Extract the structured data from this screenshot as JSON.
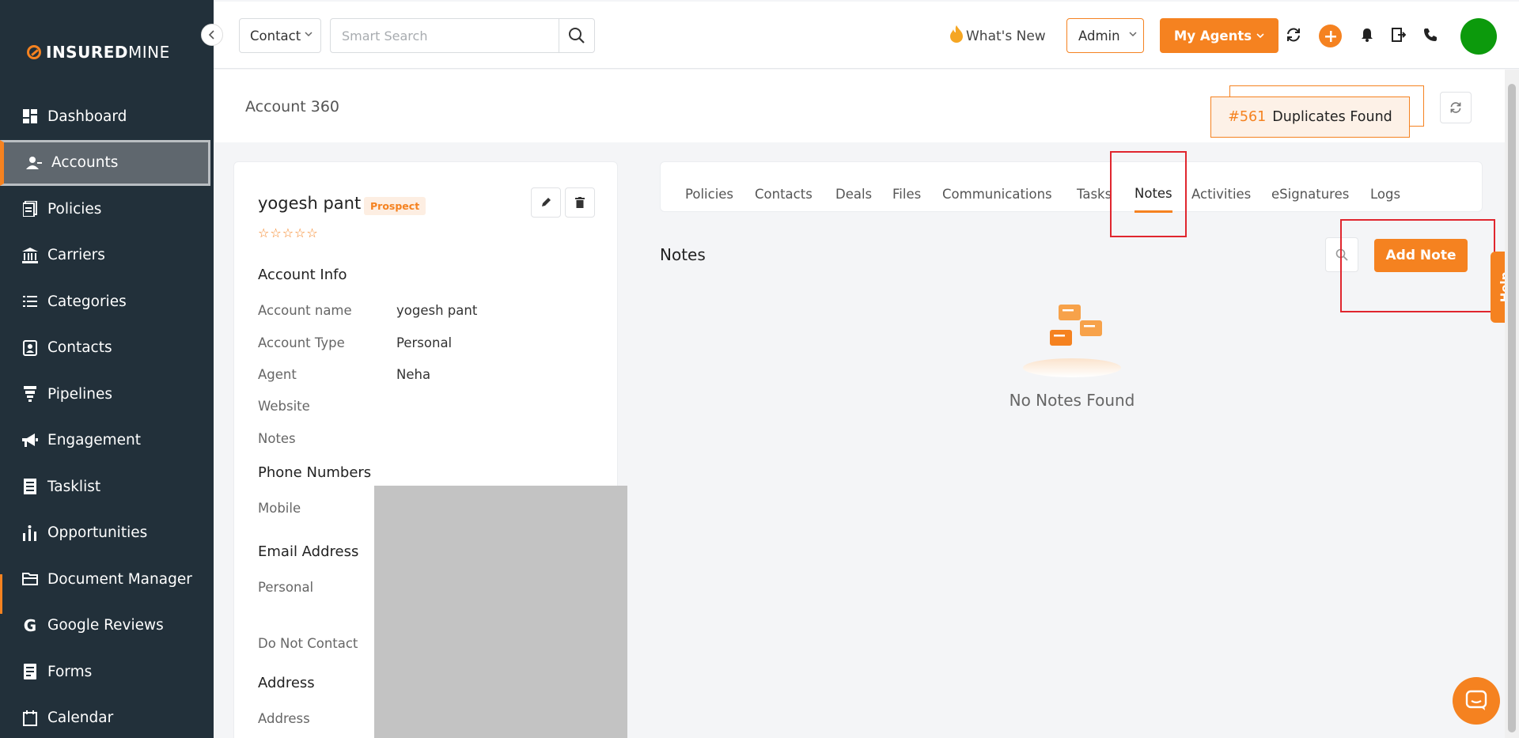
{
  "brand": {
    "name_bold": "INSURED",
    "name_light": "MINE",
    "accent": "#f58220"
  },
  "sidebar": {
    "items": [
      {
        "label": "Dashboard",
        "icon": "dashboard-icon"
      },
      {
        "label": "Accounts",
        "icon": "accounts-icon",
        "active": true
      },
      {
        "label": "Policies",
        "icon": "policies-icon"
      },
      {
        "label": "Carriers",
        "icon": "bank-icon"
      },
      {
        "label": "Categories",
        "icon": "list-icon"
      },
      {
        "label": "Contacts",
        "icon": "contact-card-icon"
      },
      {
        "label": "Pipelines",
        "icon": "funnel-icon"
      },
      {
        "label": "Engagement",
        "icon": "megaphone-icon"
      },
      {
        "label": "Tasklist",
        "icon": "tasklist-icon"
      },
      {
        "label": "Opportunities",
        "icon": "opportunities-icon"
      },
      {
        "label": "Document Manager",
        "icon": "folder-icon"
      },
      {
        "label": "Google Reviews",
        "icon": "google-icon"
      },
      {
        "label": "Forms",
        "icon": "forms-icon"
      },
      {
        "label": "Calendar",
        "icon": "calendar-icon"
      }
    ]
  },
  "topbar": {
    "search_type": "Contact",
    "search_placeholder": "Smart Search",
    "whats_new": "What's New",
    "role": "Admin",
    "my_agents": "My Agents"
  },
  "page": {
    "title": "Account 360",
    "duplicates_number": "#561",
    "duplicates_label": "Duplicates Found"
  },
  "account": {
    "name": "yogesh pant",
    "status": "Prospect",
    "stars": "☆☆☆☆☆",
    "account_info_title": "Account Info",
    "fields": [
      {
        "label": "Account name",
        "value": "yogesh pant"
      },
      {
        "label": "Account Type",
        "value": "Personal"
      },
      {
        "label": "Agent",
        "value": "Neha"
      },
      {
        "label": "Website",
        "value": ""
      },
      {
        "label": "Notes",
        "value": ""
      }
    ],
    "phone_title": "Phone Numbers",
    "phone_label": "Mobile",
    "email_title": "Email Address",
    "email_label": "Personal",
    "dnc_label": "Do Not Contact",
    "address_title": "Address",
    "address_label": "Address"
  },
  "tabs": [
    "Policies",
    "Contacts",
    "Deals",
    "Files",
    "Communications",
    "Tasks",
    "Notes",
    "Activities",
    "eSignatures",
    "Logs"
  ],
  "active_tab": "Notes",
  "notes": {
    "title": "Notes",
    "add_button": "Add Note",
    "empty_message": "No Notes Found"
  },
  "help_label": "Help"
}
